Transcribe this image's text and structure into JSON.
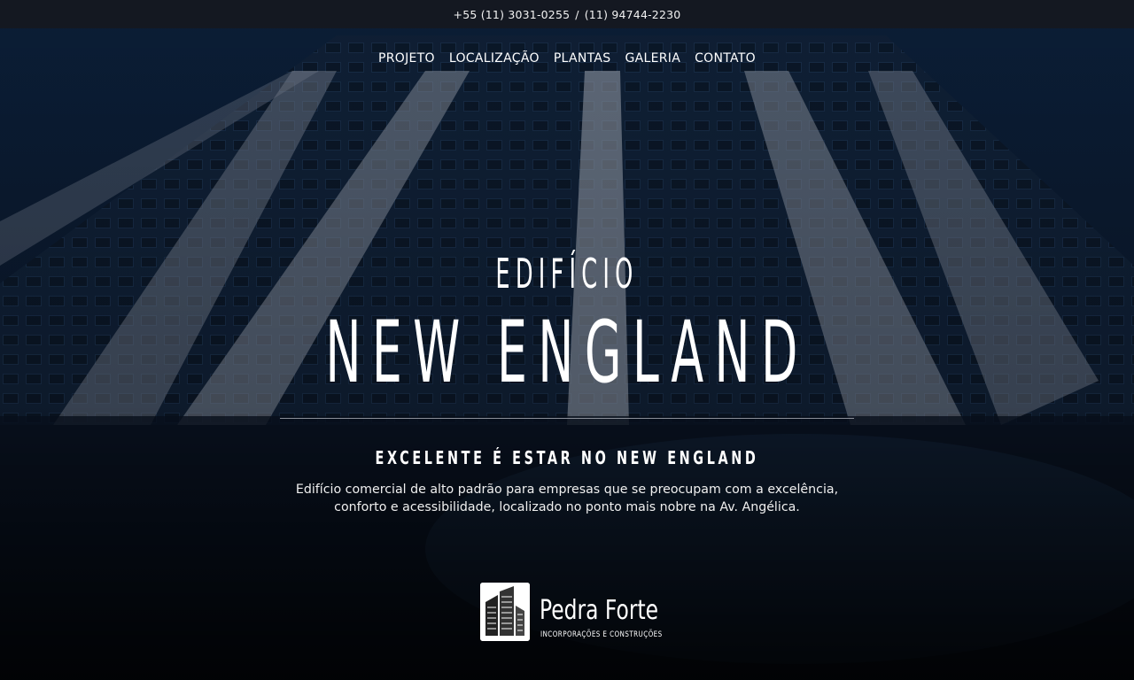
{
  "topbar": {
    "phone_primary": "+55 (11) 3031-0255",
    "separator": "/",
    "phone_secondary": "(11) 94744-2230"
  },
  "nav": {
    "items": [
      {
        "label": "PROJETO"
      },
      {
        "label": "LOCALIZAÇÃO"
      },
      {
        "label": "PLANTAS"
      },
      {
        "label": "GALERIA"
      },
      {
        "label": "CONTATO"
      }
    ]
  },
  "hero": {
    "kicker": "EDIFÍCIO",
    "title": "NEW ENGLAND",
    "tagline": "EXCELENTE É ESTAR NO NEW ENGLAND",
    "description_line1": "Edifício comercial de alto padrão para empresas que se preocupam com a excelência,",
    "description_line2": "conforto e acessibilidade, localizado no ponto mais nobre na Av. Angélica."
  },
  "logo": {
    "name": "Pedra Forte",
    "subtitle": "INCORPORAÇÕES E CONSTRUÇÕES"
  },
  "colors": {
    "topbar_bg": "#141821",
    "background": "#0b1320",
    "text": "#ffffff"
  }
}
